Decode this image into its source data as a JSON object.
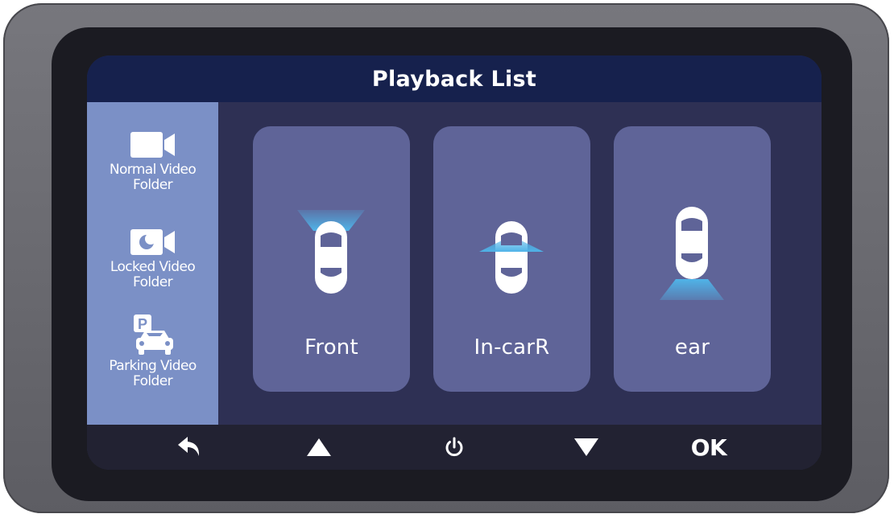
{
  "screen": {
    "title": "Playback List"
  },
  "sidebar": {
    "items": [
      {
        "line1": "Normal Video",
        "line2": "Folder",
        "icon": "video-camera-icon"
      },
      {
        "line1": "Locked Video",
        "line2": "Folder",
        "icon": "locked-camera-icon"
      },
      {
        "line1": "Parking Video",
        "line2": "Folder",
        "icon": "parking-car-icon"
      }
    ]
  },
  "cards": [
    {
      "label": "Front",
      "icon": "car-front-camera-icon"
    },
    {
      "label": "In-carR",
      "icon": "car-incar-camera-icon"
    },
    {
      "label": "ear",
      "icon": "car-rear-camera-icon"
    }
  ],
  "bottombar": {
    "buttons": [
      {
        "name": "back",
        "icon": "back-arrow-icon"
      },
      {
        "name": "up",
        "icon": "up-triangle-icon"
      },
      {
        "name": "power",
        "icon": "power-icon"
      },
      {
        "name": "down",
        "icon": "down-triangle-icon"
      },
      {
        "name": "ok",
        "label": "OK"
      }
    ]
  },
  "colors": {
    "title_bar": "#16214d",
    "sidebar": "#7b90c6",
    "content": "#2e3054",
    "card": "#5f6498",
    "bottom_bar": "#222232",
    "beam": "#4fb3e8"
  }
}
